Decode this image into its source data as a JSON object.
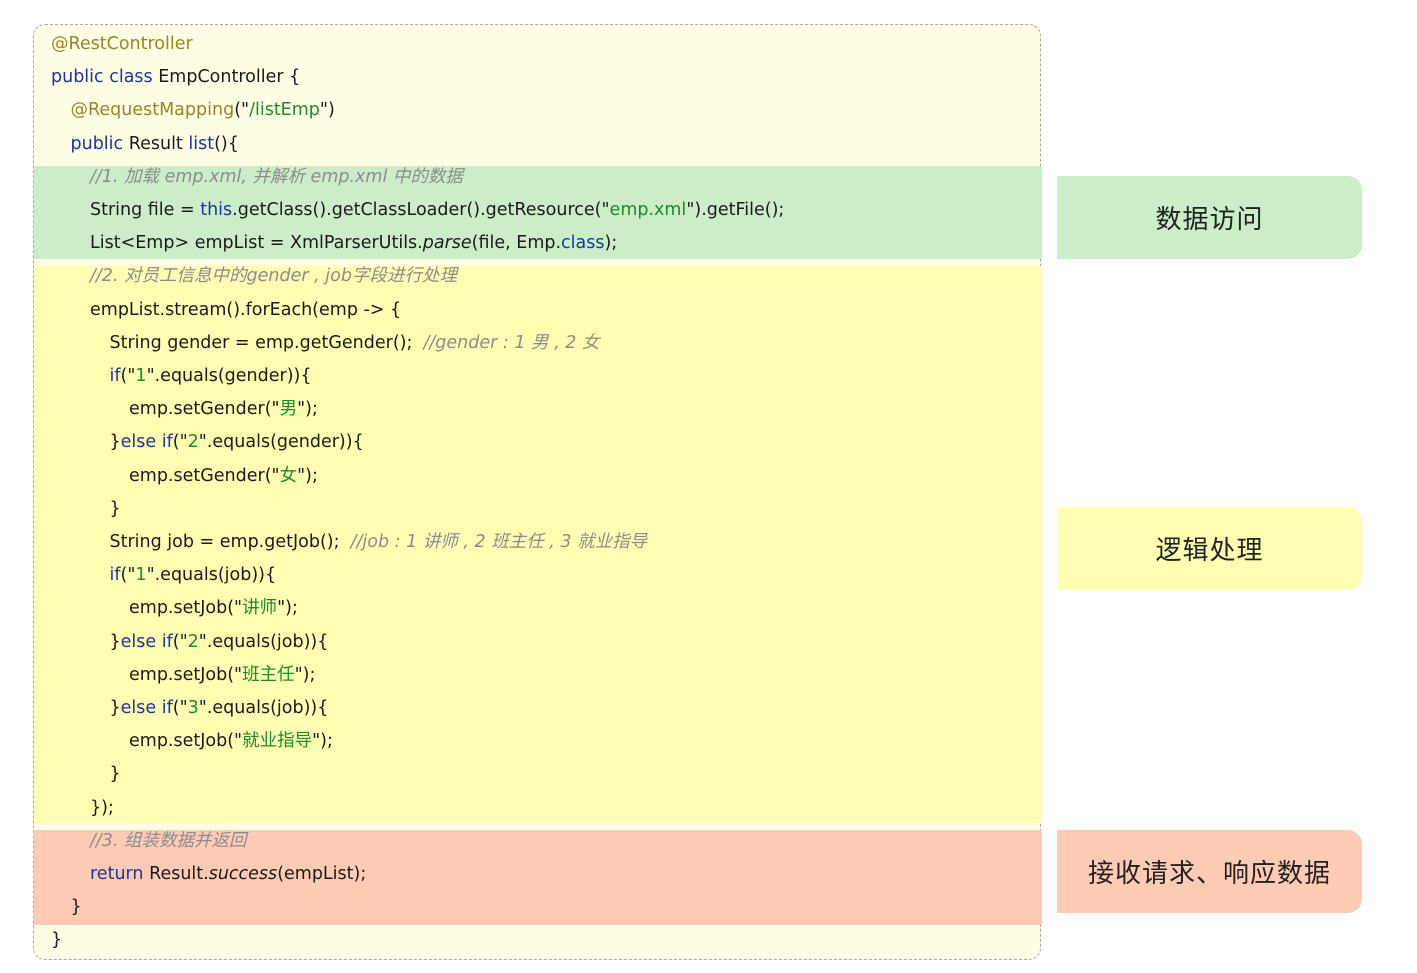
{
  "labels": {
    "data_access": "数据访问",
    "logic": "逻辑处理",
    "response": "接收请求、响应数据"
  },
  "code_lines": [
    {
      "indent": 0,
      "parts": [
        {
          "t": "@RestController",
          "c": "ann"
        }
      ]
    },
    {
      "indent": 0,
      "parts": [
        {
          "t": "public class ",
          "c": "kw"
        },
        {
          "t": "EmpController {",
          "c": ""
        }
      ]
    },
    {
      "indent": 1,
      "parts": [
        {
          "t": "@RequestMapping",
          "c": "ann"
        },
        {
          "t": "(\"",
          "c": ""
        },
        {
          "t": "/listEmp",
          "c": "str"
        },
        {
          "t": "\")",
          "c": ""
        }
      ]
    },
    {
      "indent": 1,
      "parts": [
        {
          "t": "public ",
          "c": "kw"
        },
        {
          "t": "Result ",
          "c": ""
        },
        {
          "t": "list",
          "c": "kw"
        },
        {
          "t": "(){",
          "c": ""
        }
      ]
    },
    {
      "indent": 2,
      "parts": [
        {
          "t": "//1. 加载 emp.xml, 并解析 emp.xml 中的数据",
          "c": "cm"
        }
      ]
    },
    {
      "indent": 2,
      "parts": [
        {
          "t": "String file = ",
          "c": ""
        },
        {
          "t": "this",
          "c": "kw"
        },
        {
          "t": ".getClass().getClassLoader().getResource(\"",
          "c": ""
        },
        {
          "t": "emp.xml",
          "c": "str"
        },
        {
          "t": "\").getFile();",
          "c": ""
        }
      ]
    },
    {
      "indent": 2,
      "parts": [
        {
          "t": "List<Emp> empList = XmlParserUtils.",
          "c": ""
        },
        {
          "t": "parse",
          "c": "it"
        },
        {
          "t": "(file, Emp.",
          "c": ""
        },
        {
          "t": "class",
          "c": "kw"
        },
        {
          "t": ");",
          "c": ""
        }
      ]
    },
    {
      "indent": 2,
      "parts": [
        {
          "t": "//2. 对员工信息中的gender , job字段进行处理",
          "c": "cm"
        }
      ]
    },
    {
      "indent": 2,
      "parts": [
        {
          "t": "empList.stream().forEach(emp -> {",
          "c": ""
        }
      ]
    },
    {
      "indent": 3,
      "parts": [
        {
          "t": "String gender = emp.getGender();  ",
          "c": ""
        },
        {
          "t": "//gender : 1 男 , 2 女",
          "c": "cm"
        }
      ]
    },
    {
      "indent": 3,
      "parts": [
        {
          "t": "if",
          "c": "kw"
        },
        {
          "t": "(\"",
          "c": ""
        },
        {
          "t": "1",
          "c": "str"
        },
        {
          "t": "\".equals(gender)){",
          "c": ""
        }
      ]
    },
    {
      "indent": 4,
      "parts": [
        {
          "t": "emp.setGender(\"",
          "c": ""
        },
        {
          "t": "男",
          "c": "str"
        },
        {
          "t": "\");",
          "c": ""
        }
      ]
    },
    {
      "indent": 3,
      "parts": [
        {
          "t": "}",
          "c": ""
        },
        {
          "t": "else if",
          "c": "kw"
        },
        {
          "t": "(\"",
          "c": ""
        },
        {
          "t": "2",
          "c": "str"
        },
        {
          "t": "\".equals(gender)){",
          "c": ""
        }
      ]
    },
    {
      "indent": 4,
      "parts": [
        {
          "t": "emp.setGender(\"",
          "c": ""
        },
        {
          "t": "女",
          "c": "str"
        },
        {
          "t": "\");",
          "c": ""
        }
      ]
    },
    {
      "indent": 3,
      "parts": [
        {
          "t": "}",
          "c": ""
        }
      ]
    },
    {
      "indent": 3,
      "parts": [
        {
          "t": "String job = emp.getJob();  ",
          "c": ""
        },
        {
          "t": "//job : 1 讲师 , 2 班主任 , 3 就业指导",
          "c": "cm"
        }
      ]
    },
    {
      "indent": 3,
      "parts": [
        {
          "t": "if",
          "c": "kw"
        },
        {
          "t": "(\"",
          "c": ""
        },
        {
          "t": "1",
          "c": "str"
        },
        {
          "t": "\".equals(job)){",
          "c": ""
        }
      ]
    },
    {
      "indent": 4,
      "parts": [
        {
          "t": "emp.setJob(\"",
          "c": ""
        },
        {
          "t": "讲师",
          "c": "str"
        },
        {
          "t": "\");",
          "c": ""
        }
      ]
    },
    {
      "indent": 3,
      "parts": [
        {
          "t": "}",
          "c": ""
        },
        {
          "t": "else if",
          "c": "kw"
        },
        {
          "t": "(\"",
          "c": ""
        },
        {
          "t": "2",
          "c": "str"
        },
        {
          "t": "\".equals(job)){",
          "c": ""
        }
      ]
    },
    {
      "indent": 4,
      "parts": [
        {
          "t": "emp.setJob(\"",
          "c": ""
        },
        {
          "t": "班主任",
          "c": "str"
        },
        {
          "t": "\");",
          "c": ""
        }
      ]
    },
    {
      "indent": 3,
      "parts": [
        {
          "t": "}",
          "c": ""
        },
        {
          "t": "else if",
          "c": "kw"
        },
        {
          "t": "(\"",
          "c": ""
        },
        {
          "t": "3",
          "c": "str"
        },
        {
          "t": "\".equals(job)){",
          "c": ""
        }
      ]
    },
    {
      "indent": 4,
      "parts": [
        {
          "t": "emp.setJob(\"",
          "c": ""
        },
        {
          "t": "就业指导",
          "c": "str"
        },
        {
          "t": "\");",
          "c": ""
        }
      ]
    },
    {
      "indent": 3,
      "parts": [
        {
          "t": "}",
          "c": ""
        }
      ]
    },
    {
      "indent": 2,
      "parts": [
        {
          "t": "});",
          "c": ""
        }
      ]
    },
    {
      "indent": 2,
      "parts": [
        {
          "t": "//3. 组装数据并返回",
          "c": "cm"
        }
      ]
    },
    {
      "indent": 2,
      "parts": [
        {
          "t": "return ",
          "c": "kw"
        },
        {
          "t": "Result.",
          "c": ""
        },
        {
          "t": "success",
          "c": "it"
        },
        {
          "t": "(empList);",
          "c": ""
        }
      ]
    },
    {
      "indent": 1,
      "parts": [
        {
          "t": "}",
          "c": ""
        }
      ]
    },
    {
      "indent": 0,
      "parts": [
        {
          "t": "}",
          "c": ""
        }
      ]
    }
  ]
}
